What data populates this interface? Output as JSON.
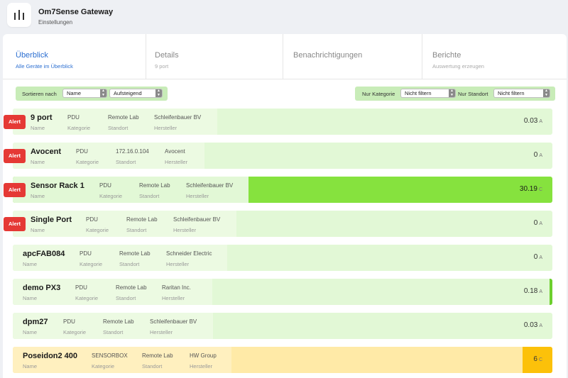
{
  "app": {
    "title": "Om7Sense Gateway",
    "subtitle": "Einstellungen"
  },
  "tabs": [
    {
      "label": "Überblick",
      "sub": "Alle Geräte im Überblick",
      "active": true
    },
    {
      "label": "Details",
      "sub": "9 port",
      "active": false
    },
    {
      "label": "Benachrichtigungen",
      "sub": "",
      "active": false
    },
    {
      "label": "Berichte",
      "sub": "Auswertung erzeugen",
      "active": false
    }
  ],
  "sort": {
    "label": "Sortieren nach",
    "field": "Name",
    "order": "Aufsteigend"
  },
  "filter": {
    "category_label": "Nur Kategorie",
    "category_value": "Nicht filtern",
    "location_label": "Nur Standort",
    "location_value": "Nicht filtern"
  },
  "col_labels": {
    "name": "Name",
    "category": "Kategorie",
    "location": "Standort",
    "vendor": "Hersteller"
  },
  "alert_label": "Alert",
  "devices": [
    {
      "name": "9 port",
      "category": "PDU",
      "location": "Remote Lab",
      "vendor": "Schleifenbauer BV",
      "value": "0.03",
      "unit": "A",
      "alert": true,
      "state": "normal"
    },
    {
      "name": "Avocent",
      "category": "PDU",
      "location": "172.16.0.104",
      "vendor": "Avocent",
      "value": "0",
      "unit": "A",
      "alert": true,
      "state": "normal"
    },
    {
      "name": "Sensor Rack 1",
      "category": "PDU",
      "location": "Remote Lab",
      "vendor": "Schleifenbauer BV",
      "value": "30.19",
      "unit": "C",
      "alert": true,
      "state": "hot"
    },
    {
      "name": "Single Port",
      "category": "PDU",
      "location": "Remote Lab",
      "vendor": "Schleifenbauer BV",
      "value": "0",
      "unit": "A",
      "alert": true,
      "state": "normal"
    },
    {
      "name": "apcFAB084",
      "category": "PDU",
      "location": "Remote Lab",
      "vendor": "Schneider Electric",
      "value": "0",
      "unit": "A",
      "alert": false,
      "state": "normal"
    },
    {
      "name": "demo PX3",
      "category": "PDU",
      "location": "Remote Lab",
      "vendor": "Raritan Inc.",
      "value": "0.18",
      "unit": "A",
      "alert": false,
      "state": "accent"
    },
    {
      "name": "dpm27",
      "category": "PDU",
      "location": "Remote Lab",
      "vendor": "Schleifenbauer BV",
      "value": "0.03",
      "unit": "A",
      "alert": false,
      "state": "normal"
    },
    {
      "name": "Poseidon2 400",
      "category": "SENSORBOX",
      "location": "Remote Lab",
      "vendor": "HW Group",
      "value": "6",
      "unit": "C",
      "alert": false,
      "state": "warn"
    }
  ],
  "colors": {
    "accent": "#2c6fd1",
    "alert": "#e53935",
    "ok": "#e2f8d6",
    "hot": "#86e23e",
    "warn": "#fcc10a"
  }
}
